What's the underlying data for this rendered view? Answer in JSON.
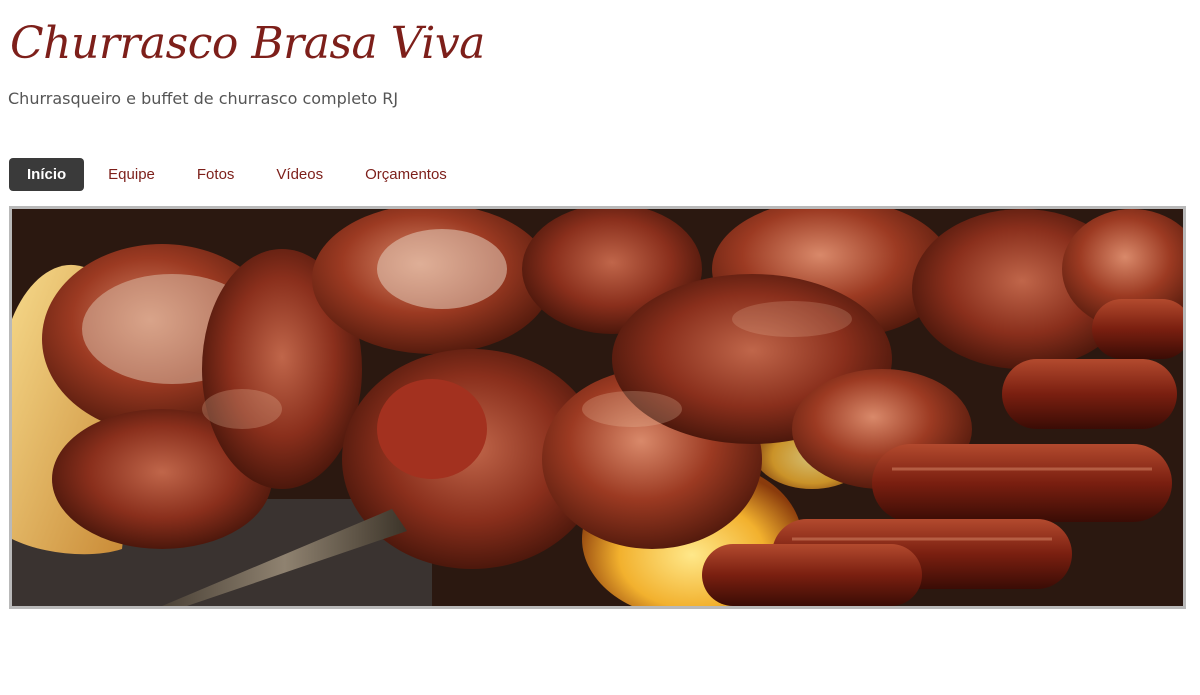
{
  "header": {
    "title": "Churrasco Brasa Viva",
    "tagline": "Churrasqueiro e buffet de churrasco completo RJ"
  },
  "nav": {
    "items": [
      {
        "label": "Início",
        "active": true
      },
      {
        "label": "Equipe",
        "active": false
      },
      {
        "label": "Fotos",
        "active": false
      },
      {
        "label": "Vídeos",
        "active": false
      },
      {
        "label": "Orçamentos",
        "active": false
      }
    ]
  },
  "colors": {
    "title": "#7d1f1a",
    "nav_active_bg": "#3a3a3a",
    "nav_link": "#7d1f1a",
    "tagline": "#555555",
    "banner_border": "#b9b9b9"
  }
}
